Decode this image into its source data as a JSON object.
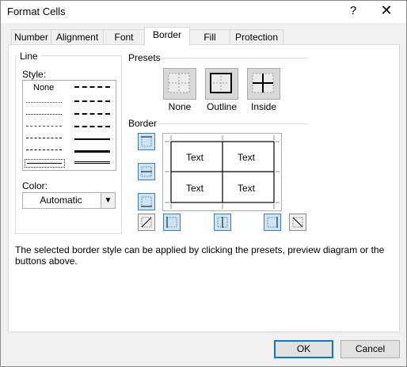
{
  "window": {
    "title": "Format Cells",
    "help": "?",
    "close": "✕"
  },
  "tabs": [
    {
      "label": "Number"
    },
    {
      "label": "Alignment"
    },
    {
      "label": "Font"
    },
    {
      "label": "Border",
      "active": true
    },
    {
      "label": "Fill"
    },
    {
      "label": "Protection"
    }
  ],
  "line_group": {
    "title": "Line",
    "style_label": "Style:",
    "style_none": "None",
    "color_label": "Color:",
    "color_value": "Automatic"
  },
  "presets": {
    "title": "Presets",
    "items": [
      {
        "label": "None"
      },
      {
        "label": "Outline"
      },
      {
        "label": "Inside"
      }
    ]
  },
  "border": {
    "title": "Border",
    "preview_cells": [
      "Text",
      "Text",
      "Text",
      "Text"
    ]
  },
  "info_text": "The selected border style can be applied by clicking the presets, preview diagram or the buttons above.",
  "buttons": {
    "ok": "OK",
    "cancel": "Cancel"
  },
  "colors": {
    "accent": "#0078d7",
    "selected_button": "#cce4f7",
    "selected_border": "#3c7fb1"
  }
}
